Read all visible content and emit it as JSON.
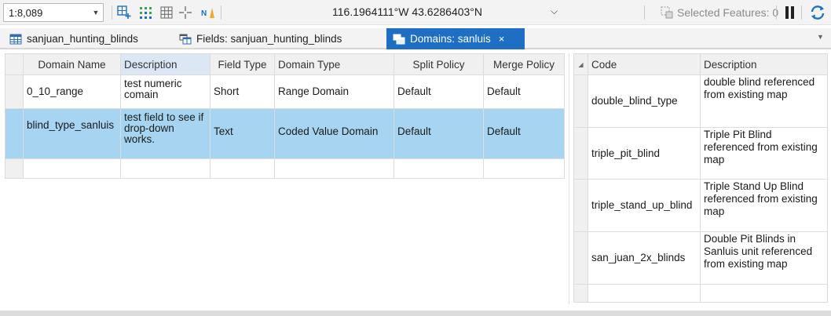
{
  "statusbar": {
    "scale": "1:8,089",
    "coordinates": "116.1964111°W 43.6286403°N",
    "selected_features": "Selected Features: 0"
  },
  "tabs": [
    {
      "label": "sanjuan_hunting_blinds",
      "icon": "table-icon"
    },
    {
      "label": "Fields:  sanjuan_hunting_blinds",
      "icon": "fields-icon"
    },
    {
      "label": "Domains: sanluis",
      "icon": "domains-icon",
      "close": "×"
    }
  ],
  "domains_grid": {
    "columns": [
      "Domain Name",
      "Description",
      "Field Type",
      "Domain Type",
      "Split Policy",
      "Merge Policy"
    ],
    "rows": [
      [
        "0_10_range",
        "test numeric comain",
        "Short",
        "Range Domain",
        "Default",
        "Default"
      ],
      [
        "blind_type_sanluis",
        "test field to see if drop-down works.",
        "Text",
        "Coded Value Domain",
        "Default",
        "Default"
      ]
    ]
  },
  "codes_grid": {
    "columns": [
      "Code",
      "Description"
    ],
    "rows": [
      [
        "double_blind_type",
        "double blind referenced from existing map"
      ],
      [
        "triple_pit_blind",
        "Triple Pit Blind referenced from existing map"
      ],
      [
        "triple_stand_up_blind",
        "Triple Stand Up Blind referenced from existing map"
      ],
      [
        "san_juan_2x_blinds",
        "Double Pit Blinds in Sanluis unit referenced from existing map"
      ]
    ]
  },
  "colors": {
    "accent": "#1e6fc4",
    "selection": "#a7d5f1",
    "header_sorted": "#dbe7f5"
  }
}
